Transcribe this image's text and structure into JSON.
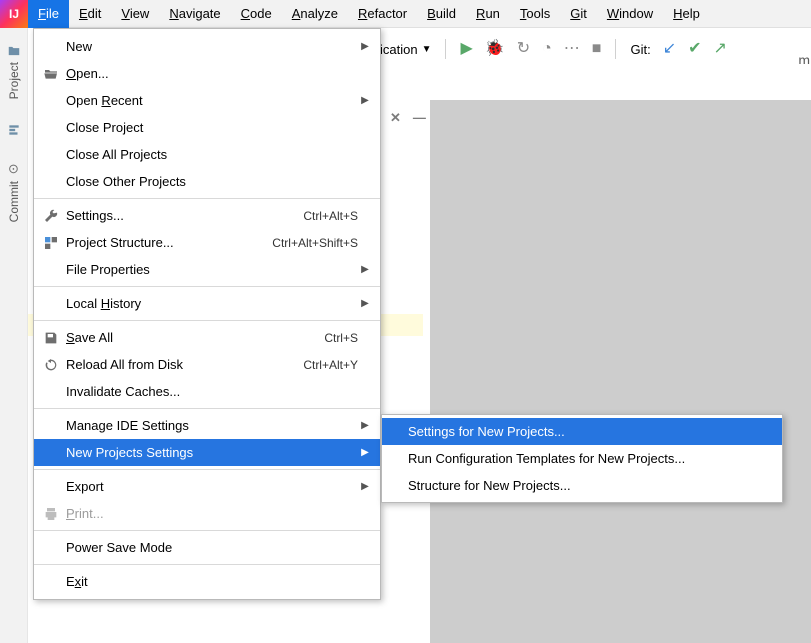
{
  "menubar": [
    {
      "label": "File",
      "active": true
    },
    {
      "label": "Edit"
    },
    {
      "label": "View"
    },
    {
      "label": "Navigate"
    },
    {
      "label": "Code"
    },
    {
      "label": "Analyze"
    },
    {
      "label": "Refactor"
    },
    {
      "label": "Build"
    },
    {
      "label": "Run"
    },
    {
      "label": "Tools"
    },
    {
      "label": "Git"
    },
    {
      "label": "Window"
    },
    {
      "label": "Help"
    }
  ],
  "toolbar": {
    "config_label": "ication",
    "git_label": "Git:"
  },
  "right_trunc": "m",
  "gutter": {
    "project": "Project",
    "commit": "Commit"
  },
  "file_menu": [
    {
      "type": "item",
      "label": "New",
      "submenu": true
    },
    {
      "type": "item",
      "label": "Open...",
      "underline": 0,
      "icon": "folder-open"
    },
    {
      "type": "item",
      "label": "Open Recent",
      "submenu": true,
      "underline": 5
    },
    {
      "type": "item",
      "label": "Close Project"
    },
    {
      "type": "item",
      "label": "Close All Projects"
    },
    {
      "type": "item",
      "label": "Close Other Projects"
    },
    {
      "type": "sep"
    },
    {
      "type": "item",
      "label": "Settings...",
      "icon": "wrench",
      "shortcut": "Ctrl+Alt+S"
    },
    {
      "type": "item",
      "label": "Project Structure...",
      "icon": "structure",
      "shortcut": "Ctrl+Alt+Shift+S"
    },
    {
      "type": "item",
      "label": "File Properties",
      "submenu": true
    },
    {
      "type": "sep"
    },
    {
      "type": "item",
      "label": "Local History",
      "underline": 6,
      "submenu": true
    },
    {
      "type": "sep"
    },
    {
      "type": "item",
      "label": "Save All",
      "underline": 0,
      "icon": "save",
      "shortcut": "Ctrl+S"
    },
    {
      "type": "item",
      "label": "Reload All from Disk",
      "icon": "reload",
      "shortcut": "Ctrl+Alt+Y"
    },
    {
      "type": "item",
      "label": "Invalidate Caches..."
    },
    {
      "type": "sep"
    },
    {
      "type": "item",
      "label": "Manage IDE Settings",
      "submenu": true
    },
    {
      "type": "item",
      "label": "New Projects Settings",
      "submenu": true,
      "highlight": true
    },
    {
      "type": "sep"
    },
    {
      "type": "item",
      "label": "Export",
      "submenu": true
    },
    {
      "type": "item",
      "label": "Print...",
      "underline": 0,
      "icon": "print",
      "disabled": true
    },
    {
      "type": "sep"
    },
    {
      "type": "item",
      "label": "Power Save Mode"
    },
    {
      "type": "sep"
    },
    {
      "type": "item",
      "label": "Exit",
      "underline": 1
    }
  ],
  "submenu": [
    {
      "label": "Settings for New Projects...",
      "highlight": true
    },
    {
      "label": "Run Configuration Templates for New Projects..."
    },
    {
      "label": "Structure for New Projects..."
    }
  ]
}
